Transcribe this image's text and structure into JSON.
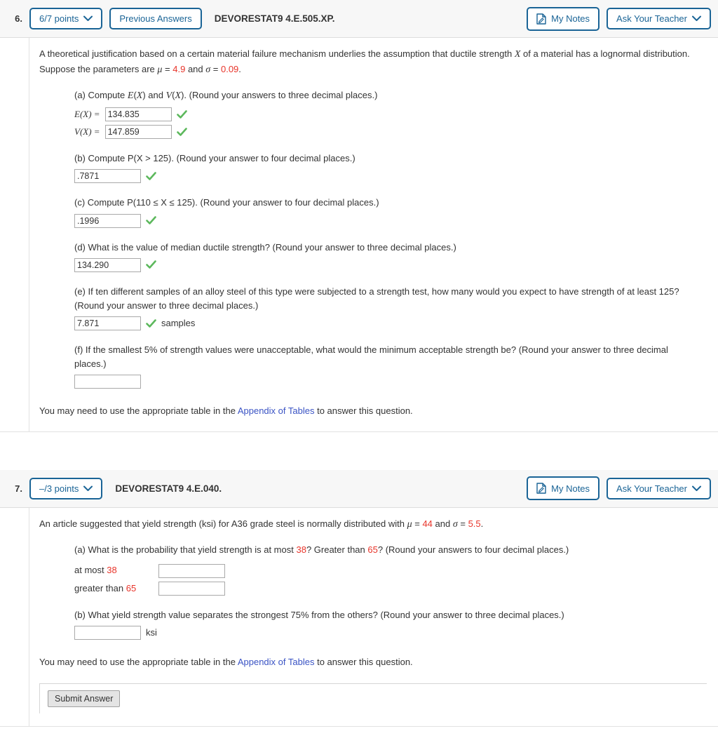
{
  "questions": [
    {
      "number": "6.",
      "points_label": "6/7 points",
      "previous_answers_label": "Previous Answers",
      "code": "DEVORESTAT9 4.E.505.XP.",
      "my_notes_label": "My Notes",
      "ask_teacher_label": "Ask Your Teacher",
      "stem": {
        "text_1": "A theoretical justification based on a certain material failure mechanism underlies the assumption that ductile strength ",
        "var_x": "X",
        "text_2": " of a material has a lognormal distribution. Suppose the parameters are ",
        "mu": "μ",
        "eq1": " = ",
        "mu_value": "4.9",
        "and": " and ",
        "sigma": "σ",
        "eq2": " = ",
        "sigma_value": "0.09",
        "period": "."
      },
      "parts": {
        "a": {
          "prompt_1": "(a) Compute ",
          "ex": "E",
          "px1": "(",
          "varx1": "X",
          "px2": ") and ",
          "vx": "V",
          "px3": "(",
          "varx2": "X",
          "px4": "). (Round your answers to three decimal places.)",
          "label_ex": "E(X) =",
          "value_ex": "134.835",
          "label_vx": "V(X) =",
          "value_vx": "147.859"
        },
        "b": {
          "prompt": "(b) Compute P(X > 125). (Round your answer to four decimal places.)",
          "value": ".7871"
        },
        "c": {
          "prompt": "(c) Compute P(110 ≤ X ≤ 125). (Round your answer to four decimal places.)",
          "value": ".1996"
        },
        "d": {
          "prompt": "(d) What is the value of median ductile strength? (Round your answer to three decimal places.)",
          "value": "134.290"
        },
        "e": {
          "prompt": "(e) If ten different samples of an alloy steel of this type were subjected to a strength test, how many would you expect to have strength of at least 125? (Round your answer to three decimal places.)",
          "value": "7.871",
          "unit": "samples"
        },
        "f": {
          "prompt": "(f) If the smallest 5% of strength values were unacceptable, what would the minimum acceptable strength be? (Round your answer to three decimal places.)",
          "value": "",
          "placeholder": ""
        }
      },
      "note": {
        "before": "You may need to use the appropriate table in the ",
        "link": "Appendix of Tables",
        "after": " to answer this question."
      }
    },
    {
      "number": "7.",
      "points_label": "–/3 points",
      "code": "DEVORESTAT9 4.E.040.",
      "my_notes_label": "My Notes",
      "ask_teacher_label": "Ask Your Teacher",
      "stem": {
        "text_1": "An article suggested that yield strength (ksi) for A36 grade steel is normally distributed with ",
        "mu": "μ",
        "eq1": " = ",
        "mu_value": "44",
        "and": " and ",
        "sigma": "σ",
        "eq2": " = ",
        "sigma_value": "5.5",
        "period": "."
      },
      "parts": {
        "a": {
          "prompt_1": "(a) What is the probability that yield strength is at most ",
          "v38": "38",
          "prompt_2": "? Greater than ",
          "v65": "65",
          "prompt_3": "? (Round your answers to four decimal places.)",
          "row1_label_pre": "at most ",
          "row1_label_num": "38",
          "row1_value": "",
          "row2_label_pre": "greater than ",
          "row2_label_num": "65",
          "row2_value": ""
        },
        "b": {
          "prompt": "(b) What yield strength value separates the strongest 75% from the others? (Round your answer to three decimal places.)",
          "value": "",
          "unit": "ksi"
        }
      },
      "note": {
        "before": "You may need to use the appropriate table in the ",
        "link": "Appendix of Tables",
        "after": " to answer this question."
      },
      "submit_label": "Submit Answer"
    }
  ],
  "colors": {
    "accent_blue": "#1a6496",
    "link_blue": "#3a53c4",
    "highlight_red": "#e8342a",
    "check_green": "#5cb85c",
    "header_bg": "#f7f7f7"
  },
  "icons": {
    "notes": "notes-page-icon",
    "chevron": "chevron-down-icon",
    "check": "check-mark-icon"
  }
}
